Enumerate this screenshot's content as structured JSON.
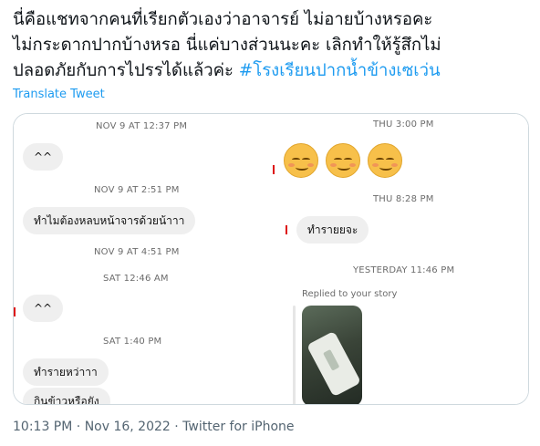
{
  "tweet": {
    "text_line1": "นี่คือแชทจากคนที่เรียกตัวเองว่าอาจารย์ ไม่อายบ้างหรอคะ",
    "text_line2": "ไม่กระดากปากบ้างหรอ นี่แค่บางส่วนนะคะ เลิกทำให้รู้สึกไม่",
    "text_line3_plain": "ปลอดภัยกับการไปรรได้แล้วค่ะ ",
    "hashtag": "#โรงเรียนปากน้ำข้างเซเว่น",
    "translate_label": "Translate Tweet"
  },
  "left_chat": {
    "ts1": "NOV 9 AT 12:37 PM",
    "msg1": "^^",
    "ts2": "NOV 9 AT 2:51 PM",
    "msg2": "ทำไมต้องหลบหน้าจารด้วยน้าาา",
    "ts3": "NOV 9 AT 4:51 PM",
    "ts4": "SAT 12:46 AM",
    "msg3": "^^",
    "ts5": "SAT 1:40 PM",
    "msg4": "ทำรายหว่าาา",
    "msg5": "กินข้าวหรือยัง"
  },
  "right_chat": {
    "ts1": "THU 3:00 PM",
    "emoji": [
      "smiling-face-icon",
      "smiling-face-icon",
      "smiling-face-icon"
    ],
    "ts2": "THU 8:28 PM",
    "msg1": "ทำรายยจะ",
    "ts3": "YESTERDAY 11:46 PM",
    "reply_label": "Replied to your story"
  },
  "footer": {
    "time": "10:13 PM",
    "sep1": " · ",
    "date": "Nov 16, 2022",
    "sep2": " · ",
    "source": "Twitter for iPhone"
  },
  "colors": {
    "link": "#1d9bf0",
    "text": "#0f1419",
    "muted": "#536471",
    "bubble": "#efefef"
  }
}
